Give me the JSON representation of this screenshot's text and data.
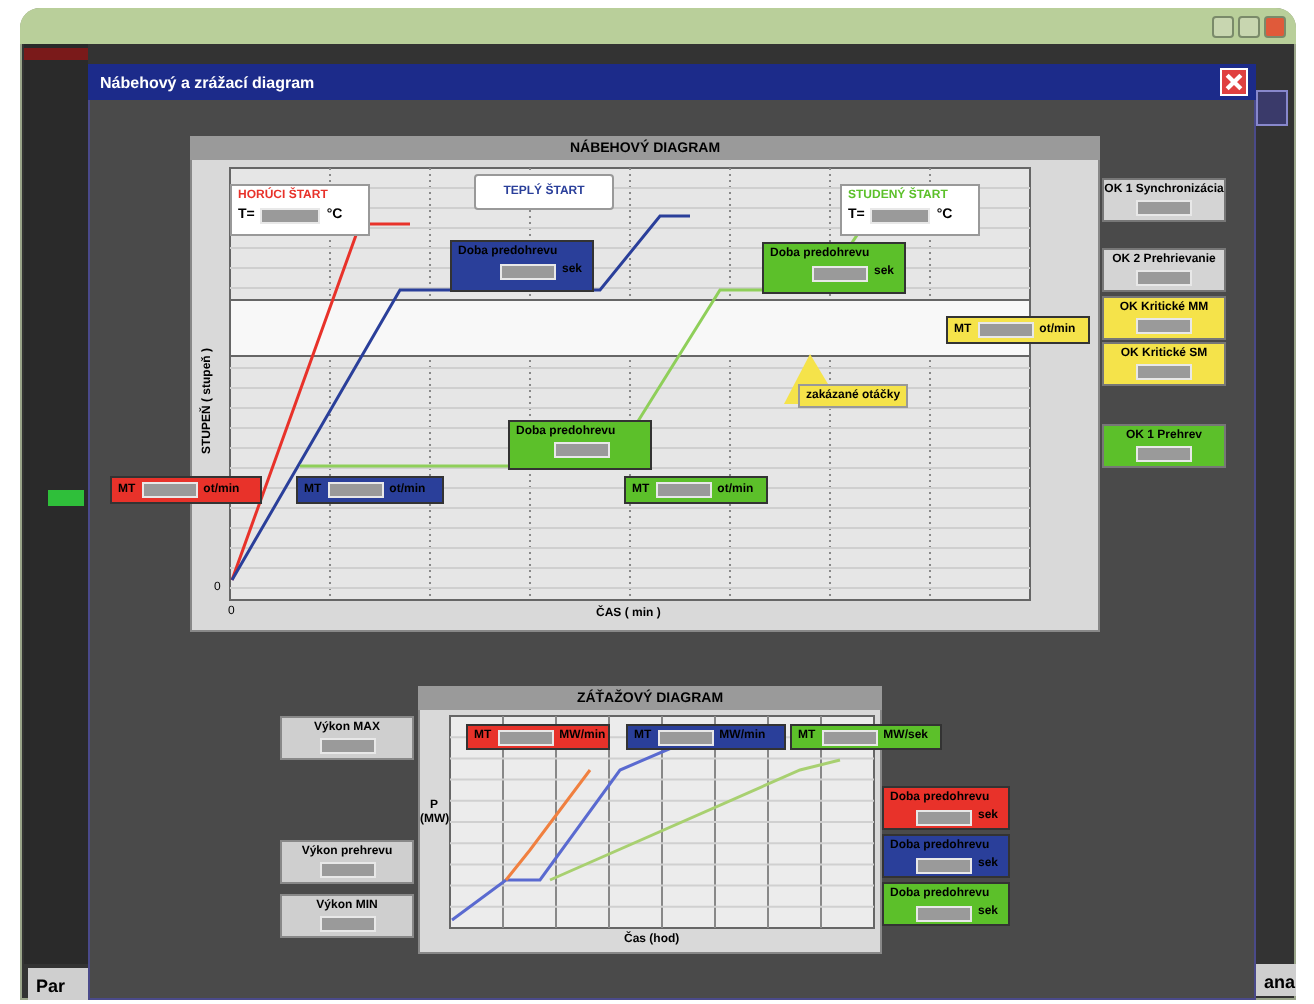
{
  "dialog": {
    "title": "Nábehový a zrážací diagram"
  },
  "top_chart": {
    "title": "NÁBEHOVÝ DIAGRAM",
    "y_label": "STUPEŇ ( stupeň )",
    "x_label": "ČAS ( min )",
    "y_origin": "0",
    "x_origin": "0",
    "boxes": [
      {
        "kind": "start",
        "color": "#e8322a",
        "title": "HORÚCI ŠTART",
        "prefix": "T=",
        "unit": "°C"
      },
      {
        "kind": "tag",
        "color": "#2a3f9a",
        "title": "TEPLÝ ŠTART"
      },
      {
        "kind": "start",
        "color": "#5cc02a",
        "title": "STUDENÝ ŠTART",
        "prefix": "T=",
        "unit": "°C"
      },
      {
        "kind": "param",
        "color": "#2a3f9a",
        "title": "Doba predohrevu",
        "unit": "sek"
      },
      {
        "kind": "param",
        "color": "#5cc02a",
        "title": "Doba predohrevu",
        "unit": "sek"
      },
      {
        "kind": "param",
        "color": "#5cc02a",
        "title": "Doba predohrevu"
      },
      {
        "kind": "speed",
        "color": "#e8322a",
        "prefix": "MT",
        "unit": "ot/min"
      },
      {
        "kind": "speed",
        "color": "#2a3f9a",
        "prefix": "MT",
        "unit": "ot/min"
      },
      {
        "kind": "speed",
        "color": "#5cc02a",
        "prefix": "MT",
        "unit": "ot/min"
      },
      {
        "kind": "speed",
        "color": "#f5e34a",
        "prefix": "MT",
        "unit": "ot/min"
      },
      {
        "kind": "note",
        "color": "#f5e34a",
        "title": "zakázané otáčky"
      }
    ]
  },
  "status_boxes": [
    {
      "label": "OK 1 Synchronizácia",
      "color": "#d4d4d4"
    },
    {
      "label": "OK 2 Prehrievanie",
      "color": "#d4d4d4"
    },
    {
      "label": "OK Kritické MM",
      "color": "#f5e34a"
    },
    {
      "label": "OK Kritické SM",
      "color": "#f5e34a"
    },
    {
      "label": "OK 1 Prehrev",
      "color": "#5cc02a"
    }
  ],
  "bottom_chart": {
    "title": "ZÁŤAŽOVÝ DIAGRAM",
    "y_label": "P (MW)",
    "x_label": "Čas (hod)",
    "boxes": [
      {
        "kind": "speed",
        "color": "#e8322a",
        "prefix": "MT",
        "unit": "MW/min"
      },
      {
        "kind": "speed",
        "color": "#2a3f9a",
        "prefix": "MT",
        "unit": "MW/min"
      },
      {
        "kind": "speed",
        "color": "#5cc02a",
        "prefix": "MT",
        "unit": "MW/sek"
      }
    ]
  },
  "power_boxes": [
    {
      "label": "Výkon MAX"
    },
    {
      "label": "Výkon prehrevu"
    },
    {
      "label": "Výkon MIN"
    }
  ],
  "bottom_right_boxes": [
    {
      "color": "#e8322a",
      "title": "Doba predohrevu",
      "unit": "sek"
    },
    {
      "color": "#2a3f9a",
      "title": "Doba predohrevu",
      "unit": "sek"
    },
    {
      "color": "#5cc02a",
      "title": "Doba predohrevu",
      "unit": "sek"
    }
  ],
  "footer": {
    "left": "Par",
    "right": "ana"
  }
}
